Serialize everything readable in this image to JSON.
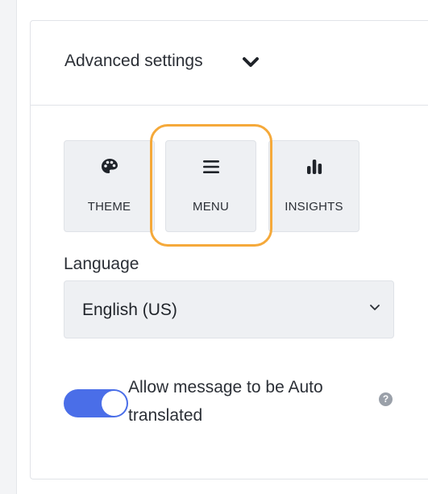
{
  "header": {
    "title": "Advanced settings",
    "chevron_icon": "chevron-down-icon"
  },
  "tabs": [
    {
      "label": "THEME",
      "icon": "palette-icon"
    },
    {
      "label": "MENU",
      "icon": "menu-icon"
    },
    {
      "label": "INSIGHTS",
      "icon": "bar-chart-icon"
    }
  ],
  "language": {
    "label": "Language",
    "selected": "English (US)",
    "chevron_icon": "chevron-down-icon"
  },
  "auto_translate": {
    "label": "Allow message to be Auto translated",
    "enabled": true,
    "help_icon": "question-mark-icon",
    "help_glyph": "?"
  },
  "colors": {
    "accent": "#4a6ee8",
    "highlight": "#f5a93a",
    "tab_bg": "#eef0f3"
  }
}
